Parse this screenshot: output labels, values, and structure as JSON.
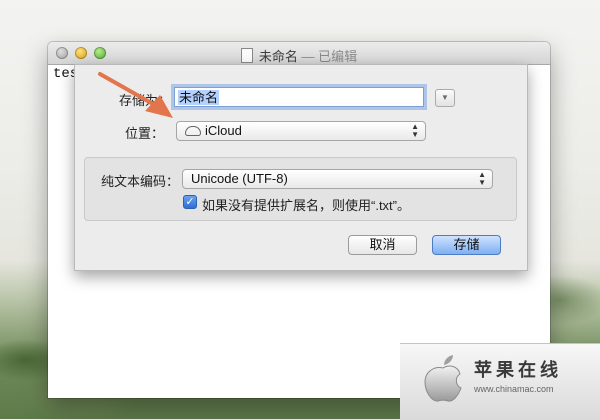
{
  "window": {
    "title": "未命名",
    "title_suffix": "— 已编辑",
    "document_text": "tes"
  },
  "dialog": {
    "save_as_label": "存储为：",
    "save_as_value": "未命名",
    "where_label": "位置：",
    "where_value": "iCloud",
    "encoding_label": "纯文本编码：",
    "encoding_value": "Unicode (UTF-8)",
    "extension_checkbox_label": "如果没有提供扩展名，则使用“.txt”。",
    "extension_checkbox_checked": true,
    "cancel_label": "取消",
    "save_label": "存储"
  },
  "watermark": {
    "name": "苹果在线",
    "url": "www.chinamac.com"
  },
  "colors": {
    "arrow": "#e2754c",
    "focus_ring": "#5f96e6",
    "default_button": "#7fb0f2"
  },
  "icons": [
    "document-icon",
    "cloud-icon",
    "expand-icon",
    "popup-arrows-icon",
    "checkmark-icon",
    "apple-logo-icon"
  ]
}
